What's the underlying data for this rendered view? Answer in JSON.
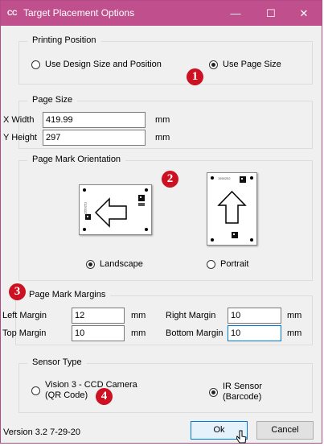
{
  "window": {
    "app_icon_text": "CC",
    "title": "Target Placement Options",
    "minimize_glyph": "—",
    "maximize_glyph": "☐",
    "close_glyph": "✕"
  },
  "printing_position": {
    "group_label": "Printing Position",
    "option_design": "Use Design Size and Position",
    "option_page": "Use Page Size",
    "selected": "option_page",
    "marker": "1"
  },
  "page_size": {
    "group_label": "Page Size",
    "x_label": "X Width",
    "x_value": "419.99",
    "x_unit": "mm",
    "y_label": "Y Height",
    "y_value": "297",
    "y_unit": "mm"
  },
  "orientation": {
    "group_label": "Page Mark Orientation",
    "marker": "2",
    "landscape_label": "Landscape",
    "portrait_label": "Portrait",
    "selected": "landscape",
    "landscape_card_code": "1550251",
    "portrait_card_code": "1550252"
  },
  "margins": {
    "group_label": "Page Mark Margins",
    "marker": "3",
    "left_label": "Left Margin",
    "left_value": "12",
    "left_unit": "mm",
    "top_label": "Top Margin",
    "top_value": "10",
    "top_unit": "mm",
    "right_label": "Right Margin",
    "right_value": "10",
    "right_unit": "mm",
    "bottom_label": "Bottom Margin",
    "bottom_value": "10",
    "bottom_unit": "mm"
  },
  "sensor": {
    "group_label": "Sensor Type",
    "vision_line1": "Vision 3 - CCD Camera",
    "vision_line2": "(QR Code)",
    "ir_line1": "IR Sensor",
    "ir_line2": "(Barcode)",
    "selected": "ir",
    "marker": "4"
  },
  "footer": {
    "version": "Version 3.2 7-29-20",
    "ok_label": "Ok",
    "cancel_label": "Cancel"
  },
  "colors": {
    "titlebar": "#c0508d",
    "marker": "#cc1122",
    "focus": "#0078d7"
  }
}
